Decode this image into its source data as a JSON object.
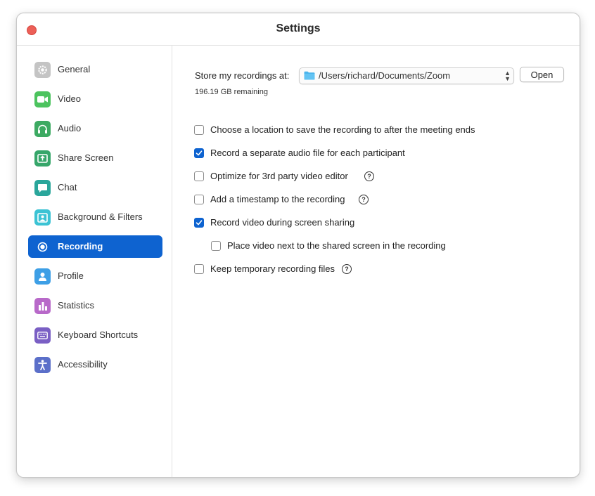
{
  "window": {
    "title": "Settings"
  },
  "sidebar": {
    "items": [
      {
        "label": "General",
        "icon": "gear-icon",
        "color": "#bdbdbd",
        "active": false
      },
      {
        "label": "Video",
        "icon": "video-camera-icon",
        "color": "#4cc35e",
        "active": false
      },
      {
        "label": "Audio",
        "icon": "headphones-icon",
        "color": "#3daa62",
        "active": false
      },
      {
        "label": "Share Screen",
        "icon": "share-screen-icon",
        "color": "#36a66a",
        "active": false
      },
      {
        "label": "Chat",
        "icon": "chat-bubble-icon",
        "color": "#2aa69b",
        "active": false
      },
      {
        "label": "Background & Filters",
        "icon": "portrait-icon",
        "color": "#3cc3d4",
        "active": false
      },
      {
        "label": "Recording",
        "icon": "record-icon",
        "color": "#ffffff",
        "active": true
      },
      {
        "label": "Profile",
        "icon": "person-icon",
        "color": "#3d9fe6",
        "active": false
      },
      {
        "label": "Statistics",
        "icon": "bar-chart-icon",
        "color": "#b869c9",
        "active": false
      },
      {
        "label": "Keyboard Shortcuts",
        "icon": "keyboard-icon",
        "color": "#7a5fc4",
        "active": false
      },
      {
        "label": "Accessibility",
        "icon": "accessibility-icon",
        "color": "#5b6fc9",
        "active": false
      }
    ]
  },
  "recording": {
    "store_label": "Store my recordings at:",
    "path": "/Users/richard/Documents/Zoom",
    "open_label": "Open",
    "remaining": "196.19 GB remaining",
    "options": [
      {
        "label": "Choose a location to save the recording to after the meeting ends",
        "checked": false,
        "help": false
      },
      {
        "label": "Record a separate audio file for each participant",
        "checked": true,
        "help": false
      },
      {
        "label": "Optimize for 3rd party video editor",
        "checked": false,
        "help": true
      },
      {
        "label": "Add a timestamp to the recording",
        "checked": false,
        "help": true
      },
      {
        "label": "Record video during screen sharing",
        "checked": true,
        "help": false
      },
      {
        "label": "Place video next to the shared screen in the recording",
        "checked": false,
        "help": false
      },
      {
        "label": "Keep temporary recording files",
        "checked": false,
        "help": true
      }
    ]
  },
  "colors": {
    "accent": "#0e63d0",
    "close": "#ec5f57"
  }
}
